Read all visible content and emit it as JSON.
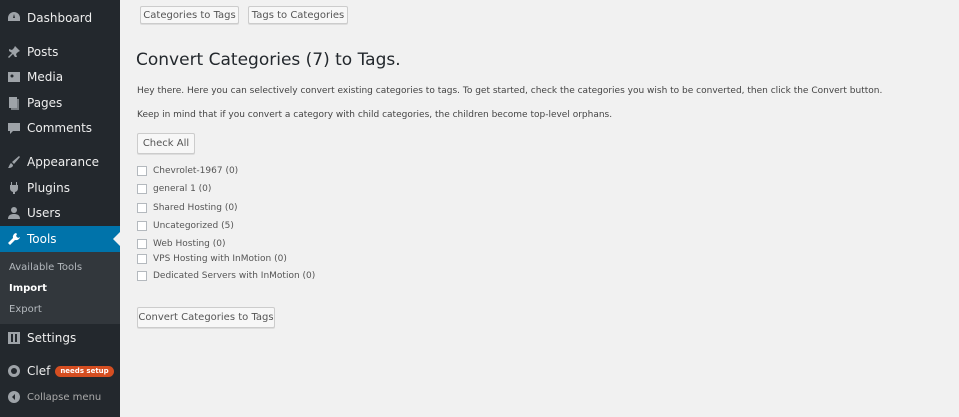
{
  "sidebar": {
    "items": [
      {
        "label": "Dashboard",
        "icon": "dashboard-icon"
      },
      {
        "label": "Posts",
        "icon": "pin-icon"
      },
      {
        "label": "Media",
        "icon": "media-icon"
      },
      {
        "label": "Pages",
        "icon": "pages-icon"
      },
      {
        "label": "Comments",
        "icon": "comment-icon"
      },
      {
        "label": "Appearance",
        "icon": "brush-icon"
      },
      {
        "label": "Plugins",
        "icon": "plug-icon"
      },
      {
        "label": "Users",
        "icon": "user-icon"
      },
      {
        "label": "Tools",
        "icon": "wrench-icon",
        "active": true
      },
      {
        "label": "Settings",
        "icon": "settings-icon"
      },
      {
        "label": "Clef",
        "icon": "clef-icon",
        "badge": "needs setup"
      }
    ],
    "submenu": [
      "Available Tools",
      "Import",
      "Export"
    ],
    "submenu_current": "Import",
    "collapse_label": "Collapse menu",
    "colors": {
      "background": "#23282d",
      "active": "#0073aa",
      "badge": "#d54e21"
    }
  },
  "top_buttons": [
    "Categories to Tags",
    "Tags to Categories"
  ],
  "main": {
    "title": "Convert Categories (7) to Tags.",
    "intro": "Hey there. Here you can selectively convert existing categories to tags. To get started, check the categories you wish to be converted, then click the Convert button.",
    "note": "Keep in mind that if you convert a category with child categories, the children become top-level orphans.",
    "check_all_label": "Check All",
    "categories": [
      "Chevrolet-1967 (0)",
      "general 1 (0)",
      "Shared Hosting (0)",
      "Uncategorized (5)",
      "Web Hosting (0)",
      "VPS Hosting with InMotion (0)",
      "Dedicated Servers with InMotion (0)"
    ],
    "convert_label": "Convert Categories to Tags"
  }
}
